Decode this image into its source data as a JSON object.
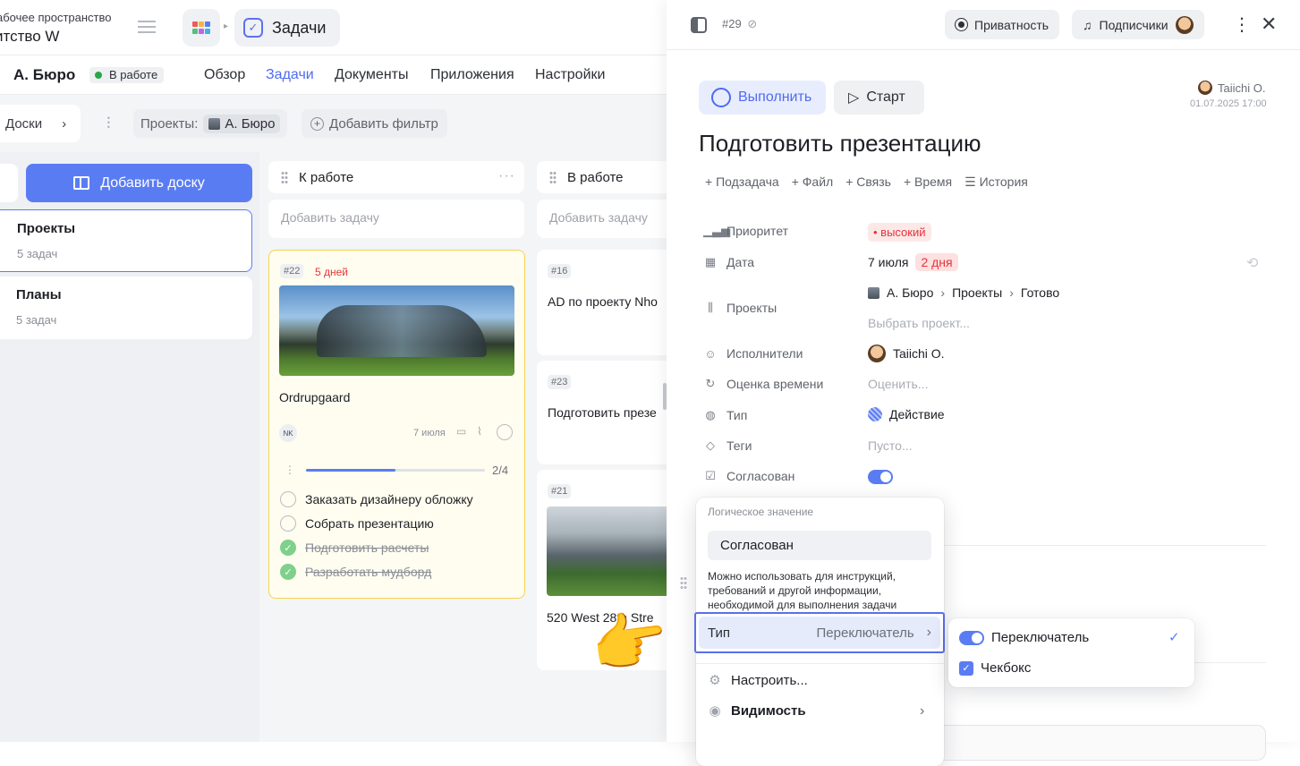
{
  "workspace": {
    "label": "абочее пространство",
    "name": "итство W"
  },
  "app": {
    "section_title": "Задачи"
  },
  "project": {
    "name": "А. Бюро",
    "status": "В работе",
    "tabs": [
      "Обзор",
      "Задачи",
      "Документы",
      "Приложения",
      "Настройки"
    ],
    "active_tab": "Задачи"
  },
  "filters": {
    "boards_label": "Доски",
    "projects_label": "Проекты:",
    "projects_value": "А. Бюро",
    "add_filter": "Добавить фильтр"
  },
  "boards": {
    "add_board": "Добавить доску",
    "items": [
      {
        "name": "Проекты",
        "count": "5 задач"
      },
      {
        "name": "Планы",
        "count": "5 задач"
      }
    ]
  },
  "columns": [
    {
      "title": "К работе",
      "more": "···",
      "add_task": "Добавить задачу"
    },
    {
      "title": "В работе",
      "add_task": "Добавить задачу"
    }
  ],
  "cards": {
    "c22": {
      "id": "#22",
      "days": "5 дней",
      "title": "Ordrupgaard",
      "assignee": "NK",
      "date": "7 июля",
      "progress_label": "2/4",
      "progress": 0.5,
      "subtasks": [
        {
          "text": "Заказать дизайнеру обложку",
          "done": false
        },
        {
          "text": "Собрать презентацию",
          "done": false
        },
        {
          "text": "Подготовить расчеты",
          "done": true
        },
        {
          "text": "Разработать мудборд",
          "done": true
        }
      ]
    },
    "c16": {
      "id": "#16",
      "title": "AD по проекту Nho"
    },
    "c23": {
      "id": "#23",
      "title": "Подготовить презе"
    },
    "c21": {
      "id": "#21",
      "title": "520 West 28th Stre"
    }
  },
  "panel": {
    "task_number": "#29",
    "privacy": "Приватность",
    "subscribers": "Подписчики",
    "complete": "Выполнить",
    "start": "Старт",
    "author": "Taiichi O.",
    "created": "01.07.2025 17:00",
    "title": "Подготовить презентацию",
    "actions": [
      "+ Подзадача",
      "+ Файл",
      "+ Связь",
      "+ Время",
      "☰ История"
    ],
    "props": {
      "priority_label": "Приоритет",
      "priority_value": "• высокий",
      "date_label": "Дата",
      "date_value": "7 июля",
      "date_badge": "2 дня",
      "projects_label": "Проекты",
      "projects_path": [
        "А. Бюро",
        "Проекты",
        "Готово"
      ],
      "projects_placeholder": "Выбрать проект...",
      "assignees_label": "Исполнители",
      "assignees_value": "Taiichi O.",
      "estimate_label": "Оценка времени",
      "estimate_placeholder": "Оценить...",
      "type_label": "Тип",
      "type_value": "Действие",
      "tags_label": "Теги",
      "tags_placeholder": "Пусто...",
      "approved_label": "Согласован",
      "approved": true
    }
  },
  "popup": {
    "section": "Логическое значение",
    "input_value": "Согласован",
    "help": "Можно использовать для инструкций, требований и другой информации, необходимой для выполнения задачи",
    "type_label": "Тип",
    "type_current": "Переключатель",
    "configure": "Настроить...",
    "visibility": "Видимость"
  },
  "submenu": {
    "options": [
      "Переключатель",
      "Чекбокс"
    ],
    "selected": "Переключатель"
  },
  "colors": {
    "accent": "#5a7cf3",
    "danger": "#e5333a",
    "highlight_border": "#f5d34e"
  }
}
